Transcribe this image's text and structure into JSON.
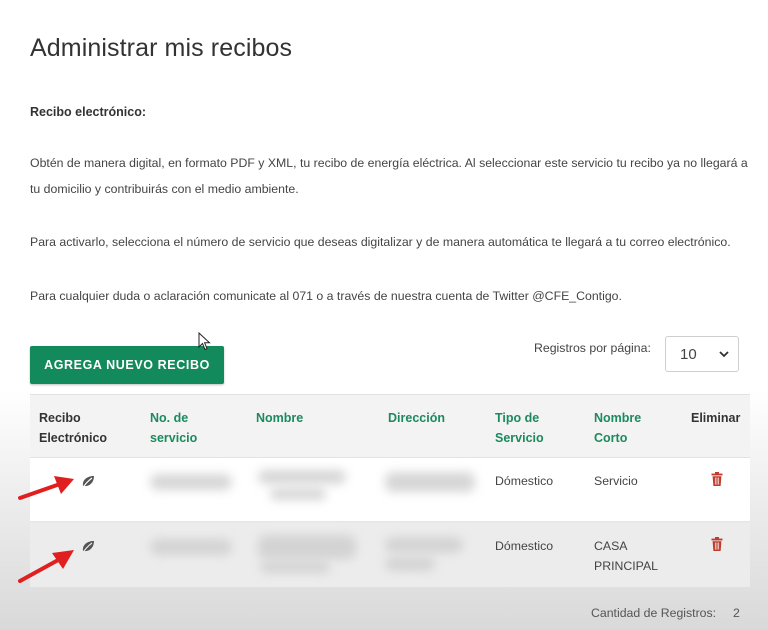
{
  "header": {
    "title": "Administrar mis recibos",
    "subtitle": "Recibo electrónico:"
  },
  "info": {
    "paragraph_1": "Obtén de manera digital, en formato PDF y XML, tu recibo de energía eléctrica. Al seleccionar este servicio tu recibo ya no llegará a tu domicilio y contribuirás con el medio ambiente.",
    "paragraph_2": "Para activarlo, selecciona el número de servicio que deseas digitalizar y de manera automática te llegará a tu correo electrónico.",
    "paragraph_3": "Para cualquier duda o aclaración comunicate al 071 o a través de nuestra cuenta de Twitter @CFE_Contigo."
  },
  "toolbar": {
    "add_button_label": "AGREGA NUEVO RECIBO",
    "per_page_label": "Registros por página:",
    "per_page_value": "10"
  },
  "table": {
    "headers": {
      "electronic_line1": "Recibo",
      "electronic_line2": "Electrónico",
      "service_line1": "No. de",
      "service_line2": "servicio",
      "name": "Nombre",
      "address": "Dirección",
      "type_line1": "Tipo de",
      "type_line2": "Servicio",
      "short_line1": "Nombre",
      "short_line2": "Corto",
      "delete": "Eliminar"
    },
    "rows": [
      {
        "icon": "leaf-icon",
        "tipo": "Dómestico",
        "short_line1": "Servicio",
        "short_line2": ""
      },
      {
        "icon": "leaf-icon",
        "tipo": "Dómestico",
        "short_line1": "CASA",
        "short_line2": "PRINCIPAL"
      }
    ]
  },
  "footer": {
    "count_label": "Cantidad de Registros:",
    "count_value": "2"
  },
  "colors": {
    "accent": "#138a5c",
    "header_green": "#1c8a5f",
    "delete_red": "#c0392b",
    "arrow_red": "#e02020"
  }
}
